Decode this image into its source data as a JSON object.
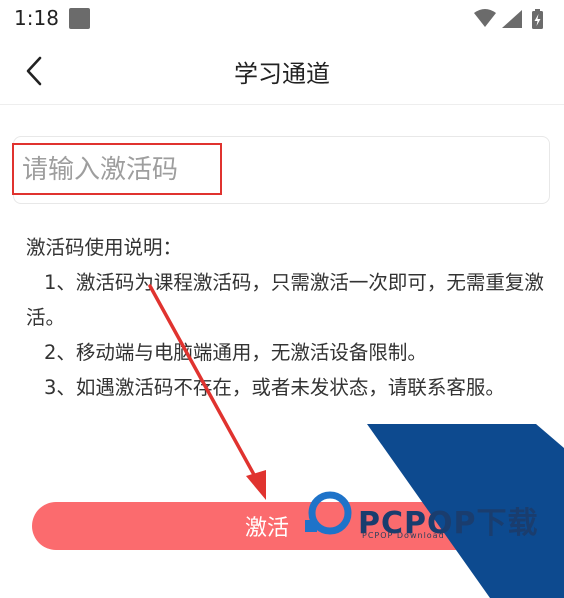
{
  "status_bar": {
    "time": "1:18"
  },
  "header": {
    "title": "学习通道"
  },
  "input": {
    "placeholder": "请输入激活码",
    "value": ""
  },
  "instructions": {
    "heading": "激活码使用说明：",
    "items": [
      "1、激活码为课程激活码，只需激活一次即可，无需重复激活。",
      "2、移动端与电脑端通用，无激活设备限制。",
      "3、如遇激活码不存在，或者未发状态，请联系客服。"
    ]
  },
  "button": {
    "label": "激活"
  },
  "watermark": {
    "brand": "PCPOP下载",
    "sub": "PCPOP Download"
  },
  "colors": {
    "button_bg": "#fb6b6e",
    "annotation_red": "#e0332f",
    "watermark_blue": "#0d4a8f"
  }
}
